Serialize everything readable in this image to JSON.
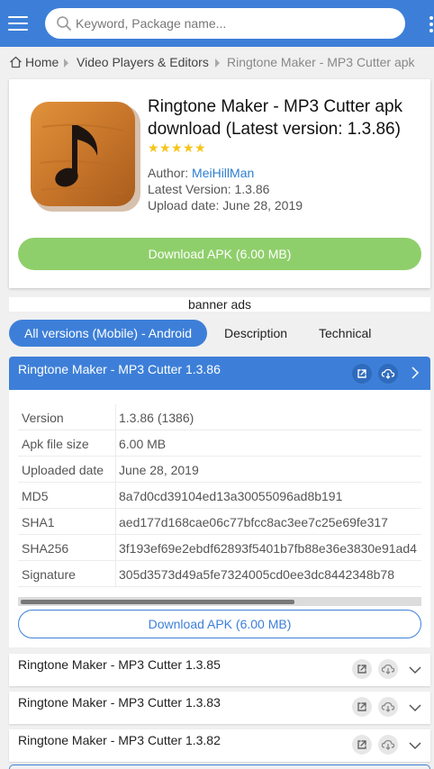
{
  "search": {
    "placeholder": "Keyword, Package name..."
  },
  "icons": {
    "menu": "menu-icon",
    "search": "search-icon",
    "more": "more-vertical-icon",
    "home": "home-icon",
    "open": "external-link-icon",
    "cloud": "cloud-download-icon",
    "chevron_right": "chevron-right-icon",
    "chevron_down": "chevron-down-icon"
  },
  "breadcrumb": {
    "home": "Home",
    "category": "Video Players & Editors",
    "current": "Ringtone Maker - MP3 Cutter apk"
  },
  "app": {
    "title": "Ringtone Maker - MP3 Cutter apk download (Latest version: 1.3.86)",
    "rating_stars": 5,
    "author_label": "Author:",
    "author": "MeiHillMan",
    "latest_version": "Latest Version: 1.3.86",
    "upload_date": "Upload date: June 28, 2019",
    "download_label": "Download APK (6.00 MB)"
  },
  "banner": "banner ads",
  "tabs": [
    {
      "label": "All versions (Mobile) - Android",
      "active": true
    },
    {
      "label": "Description",
      "active": false
    },
    {
      "label": "Technical",
      "active": false
    }
  ],
  "expanded_version": {
    "title": "Ringtone Maker - MP3 Cutter 1.3.86",
    "rows": [
      {
        "key": "Version",
        "value": "1.3.86 (1386)"
      },
      {
        "key": "Apk file size",
        "value": "6.00 MB"
      },
      {
        "key": "Uploaded date",
        "value": "June 28, 2019"
      },
      {
        "key": "MD5",
        "value": "8a7d0cd39104ed13a30055096ad8b191"
      },
      {
        "key": "SHA1",
        "value": "aed177d168cae06c77bfcc8ac3ee7c25e69fe317"
      },
      {
        "key": "SHA256",
        "value": "3f193ef69e2ebdf62893f5401b7fb88e36e3830e91ad4"
      },
      {
        "key": "Signature",
        "value": "305d3573d49a5fe7324005cd0ee3dc8442348b78"
      }
    ],
    "download_label": "Download APK (6.00 MB)"
  },
  "other_versions": [
    {
      "title": "Ringtone Maker - MP3 Cutter 1.3.85"
    },
    {
      "title": "Ringtone Maker - MP3 Cutter 1.3.83"
    },
    {
      "title": "Ringtone Maker - MP3 Cutter 1.3.82"
    }
  ],
  "colors": {
    "primary": "#3d7fd8",
    "download_green": "#8fcf6b",
    "star": "#f5c518",
    "link": "#2d7ed0"
  }
}
